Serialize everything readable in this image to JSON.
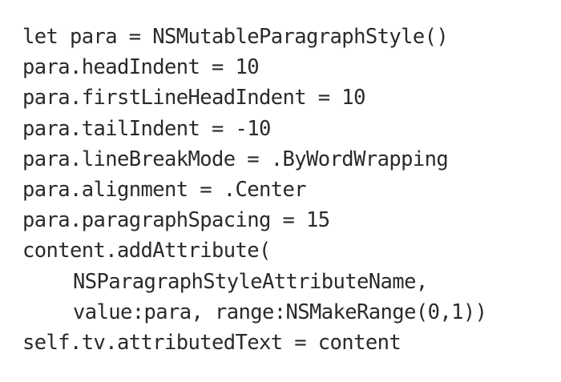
{
  "code": {
    "lines": [
      {
        "text": "let para = NSMutableParagraphStyle()"
      },
      {
        "text": "para.headIndent = 10"
      },
      {
        "text": "para.firstLineHeadIndent = 10"
      },
      {
        "text": "para.tailIndent = -10"
      },
      {
        "text": "para.lineBreakMode = .ByWordWrapping"
      },
      {
        "text": "para.alignment = .Center"
      },
      {
        "text": "para.paragraphSpacing = 15"
      },
      {
        "text": "content.addAttribute("
      },
      {
        "text": "NSParagraphStyleAttributeName,"
      },
      {
        "text": "value:para, range:NSMakeRange(0,1))"
      },
      {
        "text": "self.tv.attributedText = content"
      }
    ]
  }
}
